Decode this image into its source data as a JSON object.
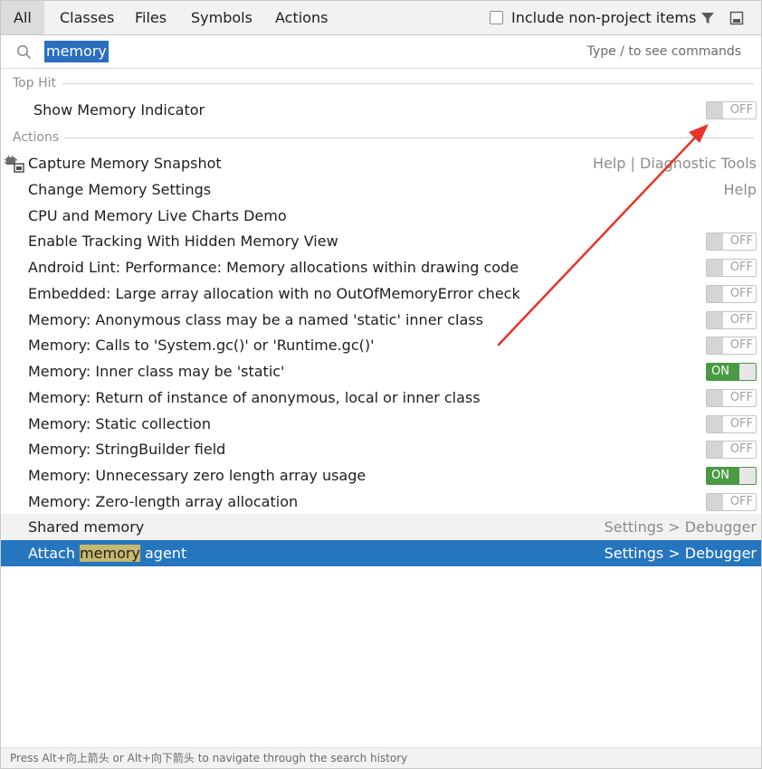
{
  "tabs": [
    {
      "label": "All",
      "active": true
    },
    {
      "label": "Classes"
    },
    {
      "label": "Files"
    },
    {
      "label": "Symbols"
    },
    {
      "label": "Actions"
    }
  ],
  "include_checkbox": {
    "label": "Include non-project items",
    "checked": false
  },
  "icons": {
    "filter": "filter-icon",
    "pin": "pin-window-icon",
    "search": "search-icon",
    "capture": "memory-snapshot-icon"
  },
  "search": {
    "value": "memory",
    "hint": "Type / to see commands"
  },
  "sections": {
    "top_hit": "Top Hit",
    "actions": "Actions"
  },
  "top_hit": {
    "label": "Show Memory Indicator",
    "toggle": "OFF"
  },
  "items": [
    {
      "label": "Capture Memory Snapshot",
      "right": "Help | Diagnostic Tools"
    },
    {
      "label": "Change Memory Settings",
      "right": "Help"
    },
    {
      "label": "CPU and Memory Live Charts Demo"
    },
    {
      "label": "Enable Tracking With Hidden Memory View",
      "toggle": "OFF"
    },
    {
      "label": "Android Lint: Performance: Memory allocations within drawing code",
      "toggle": "OFF"
    },
    {
      "label": "Embedded: Large array allocation with no OutOfMemoryError check",
      "toggle": "OFF"
    },
    {
      "label": "Memory: Anonymous class may be a named 'static' inner class",
      "toggle": "OFF"
    },
    {
      "label": "Memory: Calls to 'System.gc()' or 'Runtime.gc()'",
      "toggle": "OFF"
    },
    {
      "label": "Memory: Inner class may be 'static'",
      "toggle": "ON"
    },
    {
      "label": "Memory: Return of instance of anonymous, local or inner class",
      "toggle": "OFF"
    },
    {
      "label": "Memory: Static collection",
      "toggle": "OFF"
    },
    {
      "label": "Memory: StringBuilder field",
      "toggle": "OFF"
    },
    {
      "label": "Memory: Unnecessary zero length array usage",
      "toggle": "ON"
    },
    {
      "label": "Memory: Zero-length array allocation",
      "toggle": "OFF"
    },
    {
      "label": "Shared memory",
      "right": "Settings > Debugger"
    },
    {
      "label_parts": [
        "Attach ",
        "memory",
        " agent"
      ],
      "right": "Settings > Debugger"
    }
  ],
  "footer": {
    "text": "Press Alt+向上箭头 or Alt+向下箭头 to navigate through the search history"
  },
  "colors": {
    "selection": "#2675bf",
    "toggle_on": "#4a9a44",
    "highlight": "#c7b86f",
    "annotation_arrow": "#e8332a"
  }
}
